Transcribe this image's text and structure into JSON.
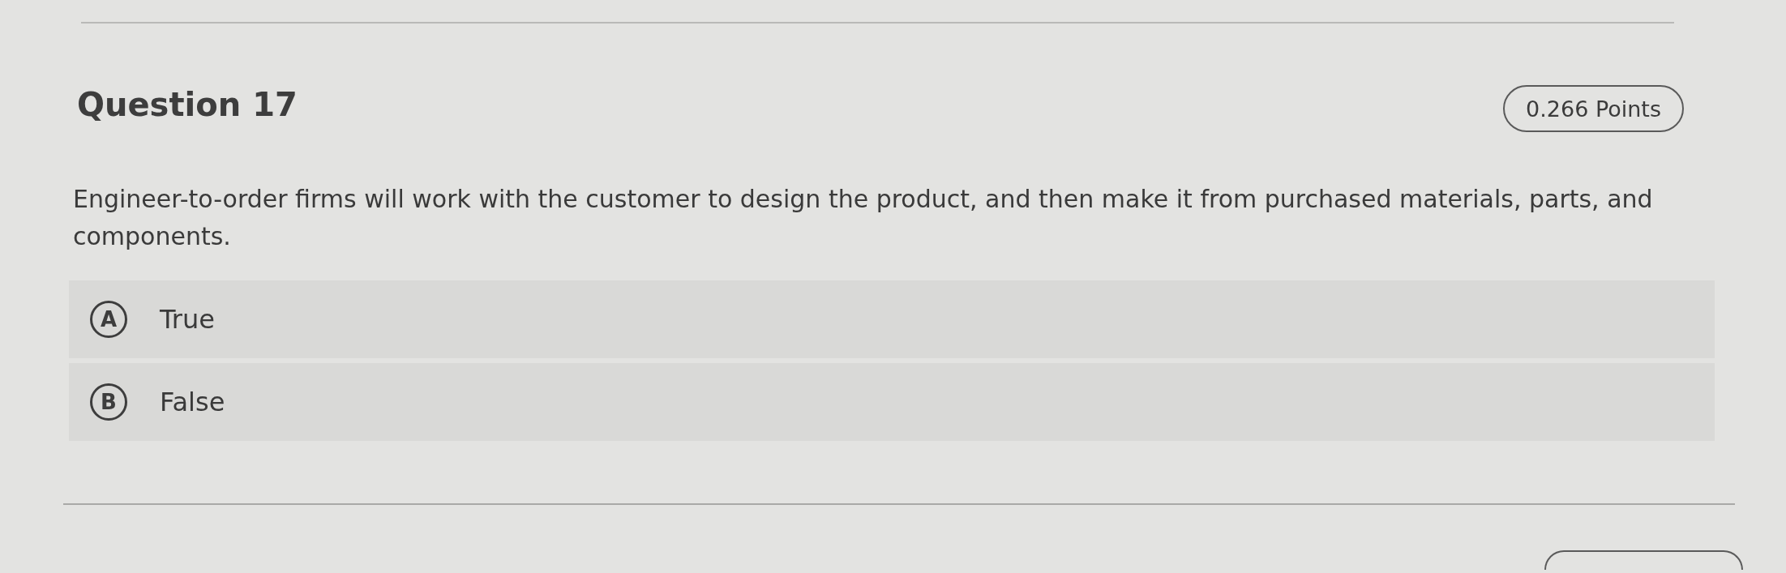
{
  "question": {
    "title": "Question 17",
    "points": "0.266 Points",
    "text": "Engineer-to-order firms will work with the customer to design the product, and then make it from purchased materials, parts, and components."
  },
  "options": [
    {
      "letter": "A",
      "label": "True",
      "selected": false
    },
    {
      "letter": "B",
      "label": "False",
      "selected": false
    }
  ]
}
